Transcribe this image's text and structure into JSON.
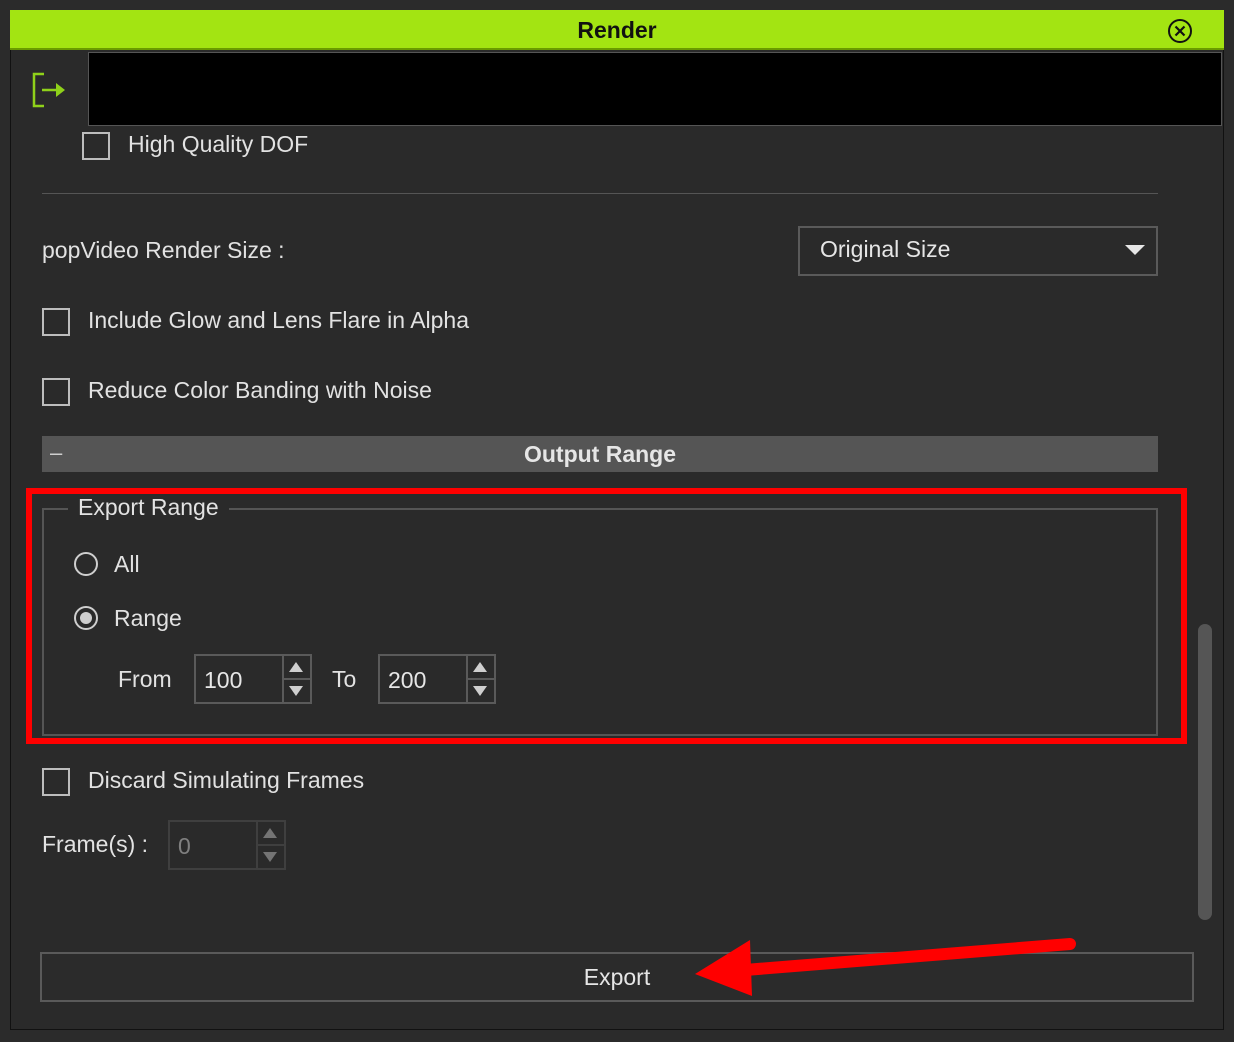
{
  "window": {
    "title": "Render",
    "accent_color": "#a3e412",
    "annotation_color": "#ff0000"
  },
  "toolbar": {
    "exit_icon": "exit-door-icon"
  },
  "options": {
    "high_quality_dof": {
      "label": "High Quality DOF",
      "checked": false
    },
    "render_size": {
      "label": "popVideo Render Size :",
      "value": "Original Size"
    },
    "include_glow": {
      "label": "Include Glow and Lens Flare in Alpha",
      "checked": false
    },
    "reduce_banding": {
      "label": "Reduce Color Banding with Noise",
      "checked": false
    }
  },
  "output_range": {
    "section_title": "Output Range",
    "collapse_symbol": "–",
    "group_label": "Export Range",
    "all_label": "All",
    "range_label": "Range",
    "selected": "Range",
    "from_label": "From",
    "from_value": "100",
    "to_label": "To",
    "to_value": "200"
  },
  "simulation": {
    "discard_label": "Discard Simulating Frames",
    "discard_checked": false,
    "frames_label": "Frame(s) :",
    "frames_value": "0"
  },
  "footer": {
    "export_label": "Export"
  }
}
